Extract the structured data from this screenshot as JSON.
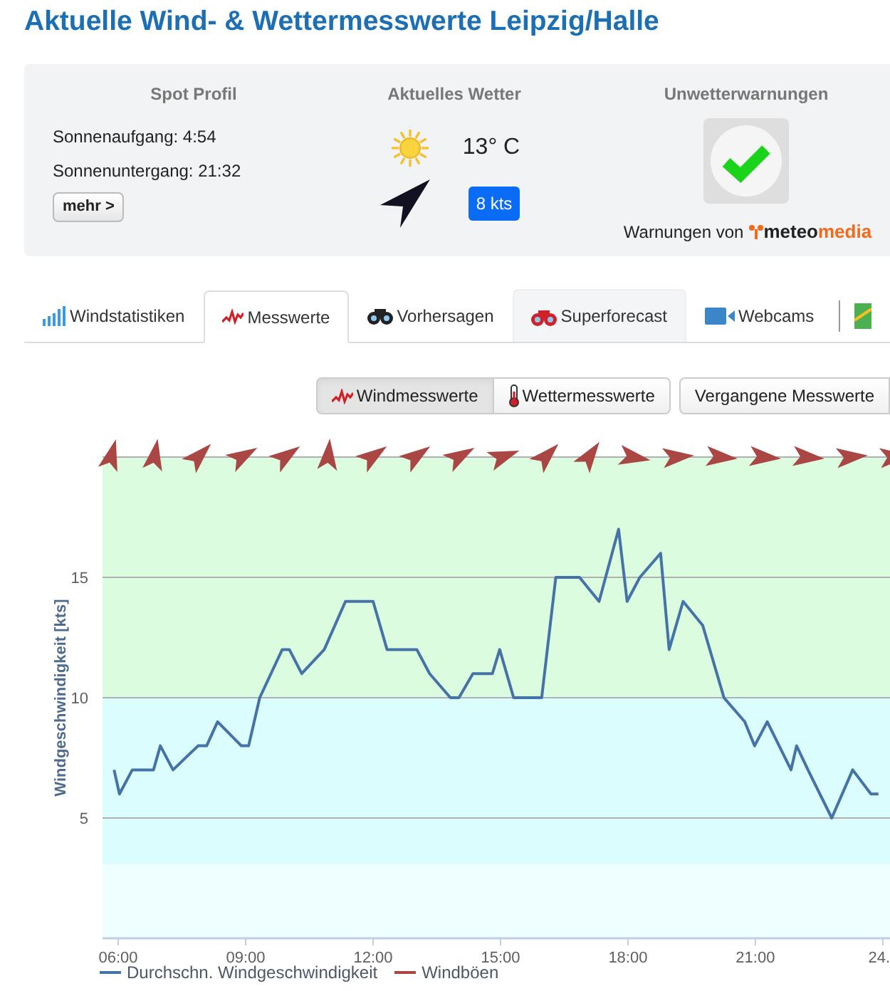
{
  "title": "Aktuelle Wind- & Wettermesswerte Leipzig/Halle",
  "panel": {
    "spot": {
      "heading": "Spot Profil",
      "lines": [
        "Sonnenaufgang: 4:54",
        "Sonnenuntergang: 21:32"
      ],
      "button": "mehr >"
    },
    "weather": {
      "heading": "Aktuelles Wetter",
      "temperature": "13° C",
      "wind": "8 kts"
    },
    "warnings": {
      "heading": "Unwetterwarnungen",
      "ok": true,
      "credit": "Warnungen von",
      "brand_a": "meteo",
      "brand_b": "media"
    }
  },
  "tabs": [
    {
      "label": "Windstatistiken",
      "selected": false,
      "kind": "plain"
    },
    {
      "label": "Messwerte",
      "selected": true,
      "kind": "plain"
    },
    {
      "label": "Vorhersagen",
      "selected": false,
      "kind": "plain"
    },
    {
      "label": "Superforecast",
      "selected": false,
      "kind": "shaded"
    },
    {
      "label": "Webcams",
      "selected": false,
      "kind": "plain"
    }
  ],
  "subtabs": [
    {
      "label": "Windmesswerte",
      "selected": true
    },
    {
      "label": "Wettermesswerte",
      "selected": false
    }
  ],
  "history_button": "Vergangene Messwerte",
  "chart_data": {
    "type": "line",
    "ylabel": "Windgeschwindigkeit [kts]",
    "xlim": [
      5.63,
      24.17
    ],
    "ylim": [
      0,
      20
    ],
    "grid": true,
    "xticks": [
      {
        "value": 6,
        "label": "06:00"
      },
      {
        "value": 9,
        "label": "09:00"
      },
      {
        "value": 12,
        "label": "12:00"
      },
      {
        "value": 15,
        "label": "15:00"
      },
      {
        "value": 18,
        "label": "18:00"
      },
      {
        "value": 21,
        "label": "21:00"
      },
      {
        "value": 24,
        "label": "24."
      }
    ],
    "yticks": [
      5,
      10,
      15
    ],
    "x": [
      5.9,
      6.03,
      6.33,
      6.83,
      6.99,
      7.29,
      7.88,
      8.08,
      8.34,
      8.9,
      9.07,
      9.33,
      9.86,
      10.03,
      10.32,
      10.85,
      11.35,
      12.0,
      12.33,
      13.03,
      13.33,
      13.82,
      14.02,
      14.35,
      14.81,
      14.98,
      15.31,
      15.97,
      16.3,
      16.86,
      17.32,
      17.78,
      17.98,
      18.28,
      18.77,
      18.97,
      19.3,
      19.76,
      20.26,
      20.75,
      20.98,
      21.28,
      21.84,
      21.97,
      22.24,
      22.8,
      23.29,
      23.72,
      23.9
    ],
    "series": [
      {
        "name": "Durchschn. Windgeschwindigkeit",
        "color": "#4572a7",
        "values": [
          7,
          6,
          7,
          7,
          8,
          7,
          8,
          8,
          9,
          8,
          8,
          10,
          12,
          12,
          11,
          12,
          14,
          14,
          12,
          12,
          11,
          10,
          10,
          11,
          11,
          12,
          10,
          10,
          15,
          15,
          14,
          17,
          14,
          15,
          16,
          12,
          14,
          13,
          10,
          9,
          8,
          9,
          7,
          8,
          7,
          5,
          7,
          6,
          6
        ]
      },
      {
        "name": "Windböen",
        "color": "#aa4643",
        "values": [
          null,
          null,
          null,
          null,
          null,
          null,
          null,
          null,
          null,
          null,
          null,
          null,
          null,
          null,
          null,
          null,
          null,
          null,
          null,
          null,
          null,
          null,
          null,
          null,
          null,
          null,
          null,
          null,
          null,
          null,
          null,
          null,
          null,
          null,
          null,
          null,
          null,
          null,
          null,
          null,
          null,
          null,
          null,
          null,
          null,
          null,
          null,
          null,
          null
        ]
      }
    ]
  }
}
